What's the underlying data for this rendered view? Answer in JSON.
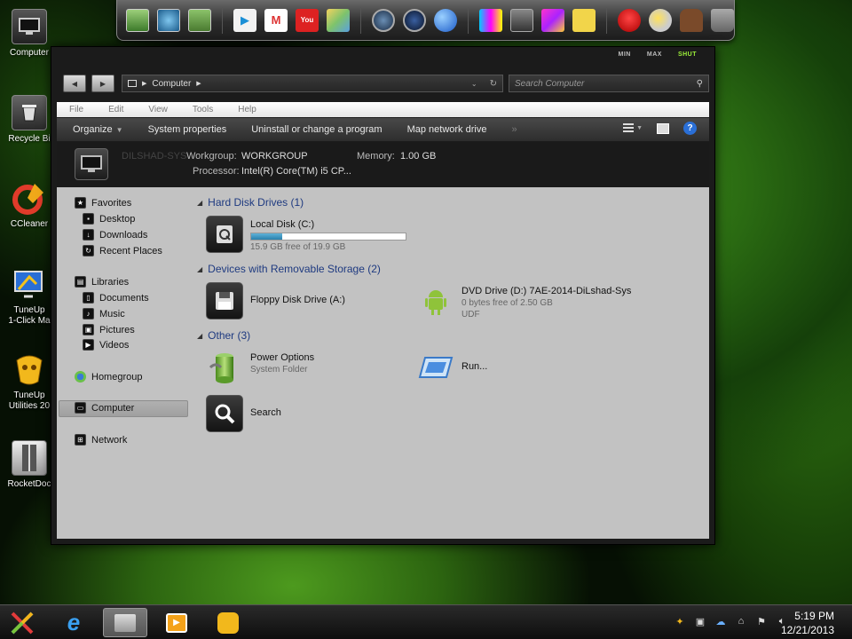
{
  "desktop": {
    "icons": [
      {
        "label": "Computer"
      },
      {
        "label": "Recycle Bi"
      },
      {
        "label": "CCleaner"
      },
      {
        "label": "TuneUp"
      },
      {
        "label": "1-Click Ma"
      },
      {
        "label": "TuneUp"
      },
      {
        "label": "Utilities 20"
      },
      {
        "label": "RocketDoc"
      }
    ]
  },
  "dock": {
    "groups": [
      [
        "monitor-icon",
        "globe-photo-icon",
        "folder-icon"
      ],
      [
        "store-bag-icon",
        "gmail-icon",
        "youtube-icon",
        "maps-icon"
      ],
      [
        "compass-icon",
        "speaker-icon",
        "earth-icon"
      ],
      [
        "color-bars-icon",
        "mixer-icon",
        "paint-icon",
        "note-icon"
      ],
      [
        "angry-bird-icon",
        "weather-icon",
        "android-icon",
        "trash-icon"
      ]
    ]
  },
  "window": {
    "controls": {
      "min": "MIN",
      "max": "MAX",
      "shut": "SHUT"
    },
    "address": {
      "path": "Computer"
    },
    "search": {
      "placeholder": "Search Computer"
    },
    "menu": [
      "File",
      "Edit",
      "View",
      "Tools",
      "Help"
    ],
    "commands": {
      "organize": "Organize",
      "system_properties": "System properties",
      "uninstall": "Uninstall or change a program",
      "map_drive": "Map network drive",
      "more": "»"
    },
    "details": {
      "name": "DILSHAD-SYS",
      "workgroup_label": "Workgroup:",
      "workgroup_value": "WORKGROUP",
      "memory_label": "Memory:",
      "memory_value": "1.00 GB",
      "processor_label": "Processor:",
      "processor_value": "Intel(R) Core(TM) i5 CP..."
    },
    "nav": {
      "favorites": "Favorites",
      "desktop": "Desktop",
      "downloads": "Downloads",
      "recent": "Recent Places",
      "libraries": "Libraries",
      "documents": "Documents",
      "music": "Music",
      "pictures": "Pictures",
      "videos": "Videos",
      "homegroup": "Homegroup",
      "computer": "Computer",
      "network": "Network"
    },
    "groups": {
      "hdd": "Hard Disk Drives (1)",
      "removable": "Devices with Removable Storage (2)",
      "other": "Other (3)"
    },
    "items": {
      "local_disk": {
        "name": "Local Disk (C:)",
        "free": "15.9 GB free of 19.9 GB",
        "used_fraction": 0.2
      },
      "floppy": {
        "name": "Floppy Disk Drive (A:)"
      },
      "dvd": {
        "name": "DVD Drive (D:) 7AE-2014-DiLshad-Sys",
        "free": "0 bytes free of 2.50 GB",
        "fs": "UDF"
      },
      "power": {
        "name": "Power Options",
        "type": "System Folder"
      },
      "run": {
        "name": "Run..."
      },
      "search": {
        "name": "Search"
      }
    }
  },
  "taskbar": {
    "time": "5:19 PM",
    "date": "12/21/2013"
  }
}
